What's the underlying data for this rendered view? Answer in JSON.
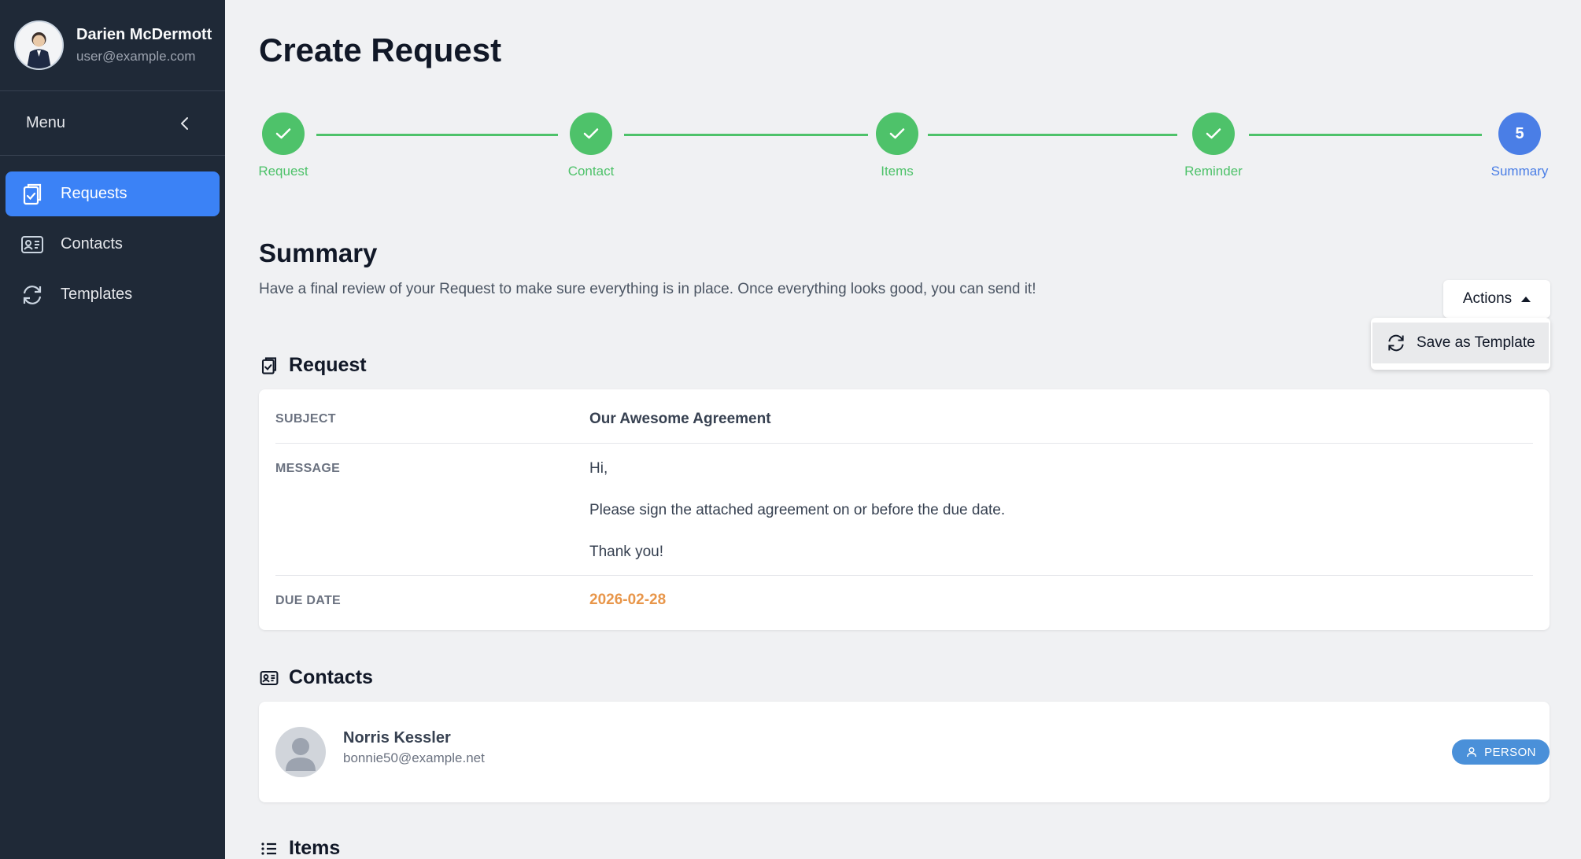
{
  "user": {
    "name": "Darien McDermott",
    "email": "user@example.com"
  },
  "sidebar": {
    "menu_label": "Menu",
    "items": [
      {
        "label": "Requests",
        "icon": "clipboard-check-icon",
        "active": true
      },
      {
        "label": "Contacts",
        "icon": "contact-card-icon",
        "active": false
      },
      {
        "label": "Templates",
        "icon": "refresh-icon",
        "active": false
      }
    ]
  },
  "page": {
    "title": "Create Request"
  },
  "stepper": {
    "steps": [
      {
        "label": "Request",
        "status": "done"
      },
      {
        "label": "Contact",
        "status": "done"
      },
      {
        "label": "Items",
        "status": "done"
      },
      {
        "label": "Reminder",
        "status": "done"
      },
      {
        "label": "Summary",
        "status": "current",
        "number": "5"
      }
    ],
    "colors": {
      "done": "#4ec26a",
      "current": "#4a7ee6"
    }
  },
  "summary": {
    "title": "Summary",
    "description": "Have a final review of your Request to make sure everything is in place. Once everything looks good, you can send it!",
    "actions_label": "Actions",
    "dropdown": {
      "save_template_label": "Save as Template"
    }
  },
  "request": {
    "heading": "Request",
    "subject_key": "SUBJECT",
    "subject_value": "Our Awesome Agreement",
    "message_key": "MESSAGE",
    "message_lines": [
      "Hi,",
      "Please sign the attached agreement on or before the due date.",
      "Thank you!"
    ],
    "due_key": "DUE DATE",
    "due_value": "2026-02-28"
  },
  "contacts": {
    "heading": "Contacts",
    "items": [
      {
        "name": "Norris Kessler",
        "email": "bonnie50@example.net",
        "type": "PERSON"
      }
    ]
  },
  "items": {
    "heading": "Items"
  }
}
